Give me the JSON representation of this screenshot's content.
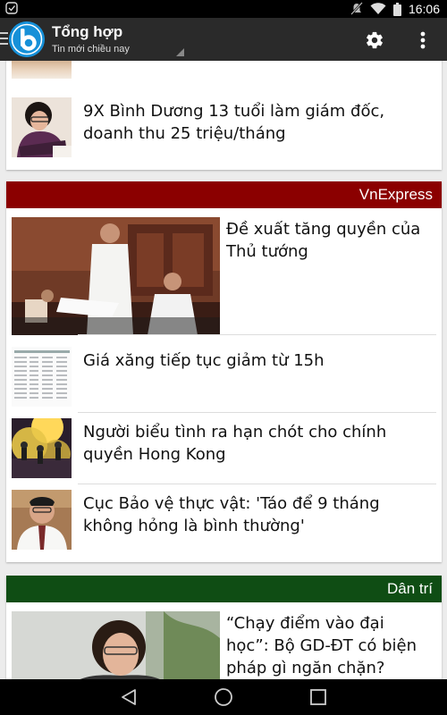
{
  "status_bar": {
    "time": "16:06",
    "icons": [
      "notification-icon",
      "mute-icon",
      "wifi-icon",
      "battery-icon"
    ]
  },
  "app_bar": {
    "title": "Tổng hợp",
    "subtitle": "Tin mới chiều nay",
    "icons": [
      "menu-icon",
      "app-logo",
      "settings-icon",
      "overflow-menu-icon"
    ]
  },
  "sections": [
    {
      "source": "",
      "articles": [
        {
          "headline": "9X Bình Dương 13 tuổi làm giám đốc, doanh thu 25 triệu/tháng"
        }
      ]
    },
    {
      "source": "VnExpress",
      "color": "#8b0000",
      "articles": [
        {
          "headline": "Đề xuất tăng quyền của Thủ tướng"
        },
        {
          "headline": "Giá xăng tiếp tục giảm từ 15h"
        },
        {
          "headline": "Người biểu tình ra hạn chót cho chính quyền Hong Kong"
        },
        {
          "headline": "Cục Bảo vệ thực vật: 'Táo để 9 tháng không hỏng là bình thường'"
        }
      ]
    },
    {
      "source": "Dân trí",
      "color": "#0f4d14",
      "articles": [
        {
          "headline": "“Chạy điểm vào đại học”: Bộ GD-ĐT có biện pháp gì ngăn chặn?"
        }
      ]
    }
  ],
  "nav_bar": {
    "icons": [
      "back-icon",
      "home-icon",
      "recents-icon"
    ]
  }
}
